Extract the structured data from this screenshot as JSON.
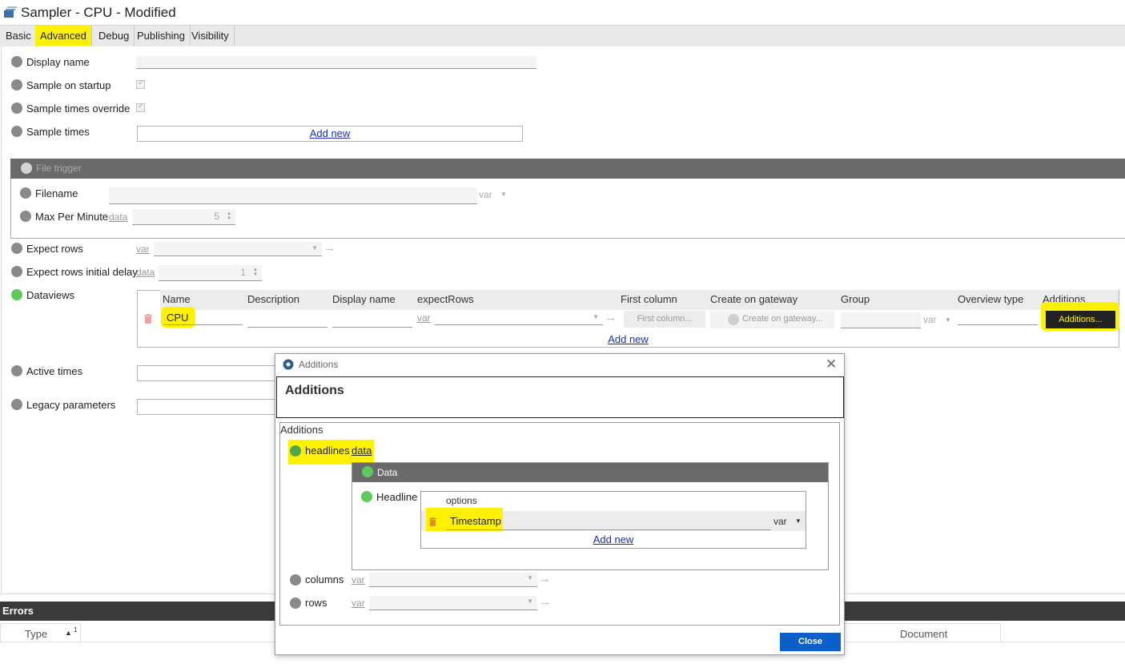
{
  "window": {
    "title": "Sampler - CPU - Modified",
    "app_icon": "sampler-icon"
  },
  "tabs": [
    {
      "label": "Basic"
    },
    {
      "label": "Advanced",
      "active": true
    },
    {
      "label": "Debug"
    },
    {
      "label": "Publishing"
    },
    {
      "label": "Visibility"
    }
  ],
  "form": {
    "display_name": {
      "label": "Display name",
      "value": ""
    },
    "sample_on_startup": {
      "label": "Sample on startup",
      "checked": true
    },
    "sample_times_override": {
      "label": "Sample times override",
      "checked": true
    },
    "sample_times": {
      "label": "Sample times",
      "add_new": "Add new"
    },
    "file_trigger": {
      "title": "File trigger",
      "filename": {
        "label": "Filename",
        "mode": "var"
      },
      "max_per_minute": {
        "label": "Max Per Minute",
        "mode": "data",
        "value": "5"
      }
    },
    "expect_rows": {
      "label": "Expect rows",
      "mode": "var"
    },
    "expect_rows_initial_delay": {
      "label": "Expect rows initial delay",
      "mode": "data",
      "value": "1"
    },
    "dataviews": {
      "label": "Dataviews",
      "columns": [
        "Name",
        "Description",
        "Display name",
        "expectRows",
        "First column",
        "Create on gateway",
        "Group",
        "Overview type",
        "Additions"
      ],
      "rows": [
        {
          "name": "CPU",
          "description": "",
          "display_name": "",
          "expect_rows_mode": "var",
          "first_column": "First column...",
          "create_on_gateway": "Create on gateway...",
          "group_mode": "var",
          "overview_type": "",
          "additions_button": "Additions..."
        }
      ],
      "add_new": "Add new"
    },
    "active_times": {
      "label": "Active times"
    },
    "legacy_parameters": {
      "label": "Legacy parameters"
    }
  },
  "errors_panel": {
    "title": "Errors",
    "columns": [
      "Type",
      "Document"
    ],
    "sort_marker": "1"
  },
  "dialog": {
    "window_title": "Additions",
    "heading": "Additions",
    "group_label": "Additions",
    "headlines": {
      "label": "headlines",
      "mode": "data"
    },
    "data_section": {
      "title": "Data",
      "headline": {
        "label": "Headline",
        "options_label": "options",
        "option_value": "Timestamp",
        "option_mode": "var",
        "add_new": "Add new"
      }
    },
    "columns": {
      "label": "columns",
      "mode": "var"
    },
    "rows": {
      "label": "rows",
      "mode": "var"
    },
    "close_button": "Close"
  },
  "colors": {
    "highlight": "#fff200",
    "section_header": "#6a6a6a",
    "dark_bar": "#3a3a3a",
    "primary_button": "#0a5fc8",
    "status_green": "#5ccb5c"
  }
}
